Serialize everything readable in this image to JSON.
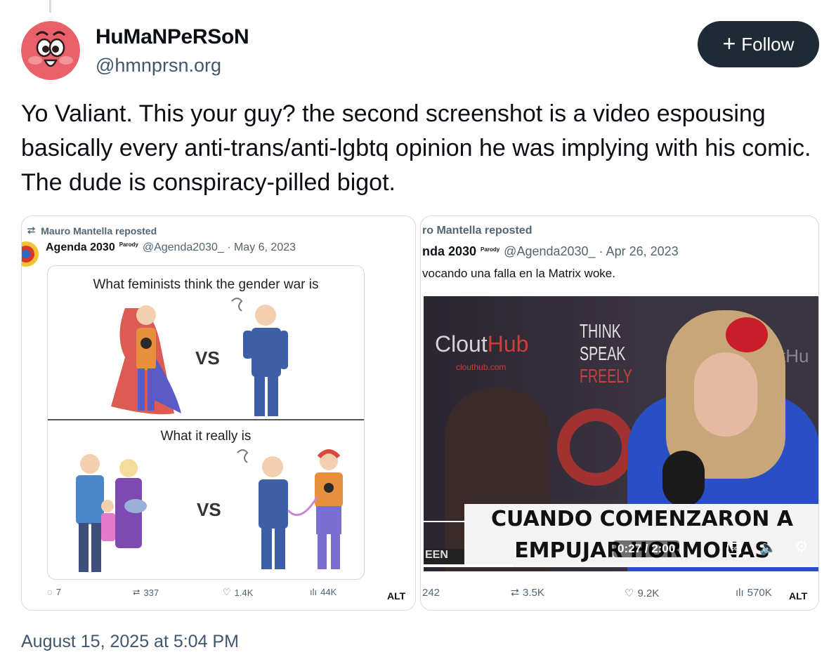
{
  "author": {
    "display_name": "HuMaNPeRSoN",
    "handle": "@hmnprsn.org",
    "avatar_icon": "cartoon-face-avatar"
  },
  "follow_button": {
    "label": "Follow",
    "icon": "plus-icon",
    "bg": "#1f2a37"
  },
  "post": {
    "text": "Yo Valiant. This your guy? the second screenshot is a video espousing basically every anti-trans/anti-lgbtq opinion he was implying with his comic. The dude is conspiracy-pilled bigot.",
    "timestamp": "August 15, 2025 at 5:04 PM"
  },
  "images": [
    {
      "repost": "Mauro Mantella reposted",
      "author": "Agenda 2030",
      "parody": "Parody",
      "meta": "@Agenda2030_ · May 6, 2023",
      "comic_top": "What feminists think the gender war is",
      "comic_bottom": "What it really is",
      "vs": "VS",
      "stats": {
        "replies": "7",
        "reposts": "337",
        "likes": "1.4K",
        "views": "44K"
      },
      "alt": "ALT"
    },
    {
      "repost": "ro Mantella reposted",
      "author": "nda 2030",
      "parody": "Parody",
      "meta": "@Agenda2030_ · Apr 26, 2023",
      "tweet_text": "vocando una falla en la Matrix woke.",
      "video_sign": {
        "brand": "CloutHub",
        "brand_a": "Clout",
        "brand_b": "Hub",
        "url": "clouthub.com",
        "slogan_1": "THINK",
        "slogan_2": "SPEAK",
        "slogan_3": "FREELY",
        "side": "tHu"
      },
      "caption_1": "CUANDO COMENZARON A",
      "caption_2": "EMPUJAR HORMONAS",
      "time": "0:27 / 2:00",
      "ticker": "EEN",
      "stats": {
        "replies": "242",
        "reposts": "3.5K",
        "likes": "9.2K",
        "views": "570K"
      },
      "alt": "ALT"
    }
  ]
}
